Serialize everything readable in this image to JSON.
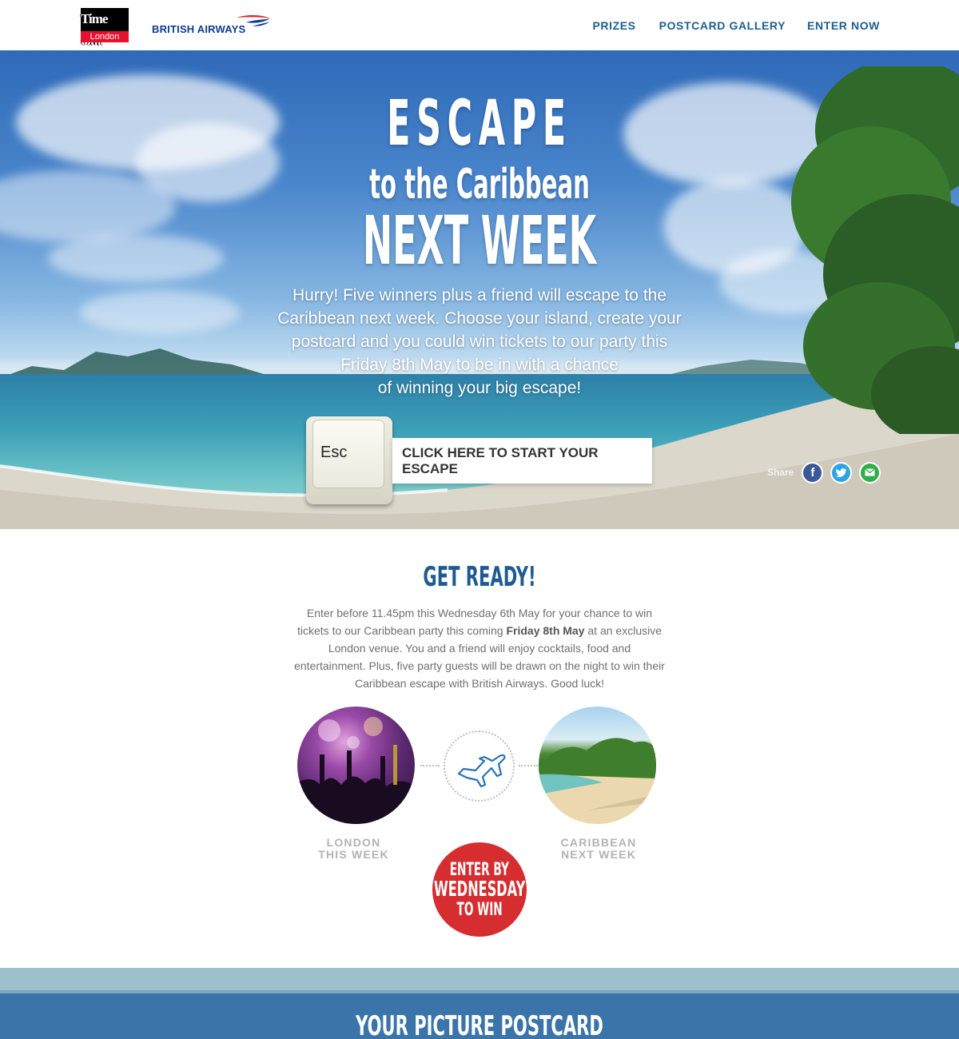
{
  "header": {
    "timeout_logo": {
      "main": "Time Out",
      "sub": "London"
    },
    "ba_logo": {
      "text": "BRITISH AIRWAYS"
    },
    "nav": [
      {
        "label": "PRIZES"
      },
      {
        "label": "POSTCARD GALLERY"
      },
      {
        "label": "ENTER NOW"
      }
    ]
  },
  "hero": {
    "title_line1": "ESCAPE",
    "title_line2": "to the Caribbean",
    "title_line3": "NEXT WEEK",
    "body_lines": [
      "Hurry! Five winners plus a friend will escape to the",
      "Caribbean next week. Choose your island, create your",
      "postcard and you could win tickets to our party this",
      "Friday 8th May to be in with a chance",
      "of winning your big escape!"
    ],
    "esc_key_label": "Esc",
    "cta_label": "CLICK HERE TO START YOUR ESCAPE",
    "share": {
      "label": "Share",
      "icons": [
        "facebook-icon",
        "twitter-icon",
        "email-icon"
      ],
      "colors": {
        "facebook": "#3b5998",
        "twitter": "#2ea3e3",
        "email": "#2fae4c"
      }
    }
  },
  "get_ready": {
    "title": "GET READY!",
    "body_part1": "Enter before 11.45pm this Wednesday 6th May for your chance to win tickets to our Caribbean party this coming ",
    "body_bold": "Friday 8th May",
    "body_part2": " at an exclusive London venue. You and a friend will enjoy cocktails, food and entertainment. Plus, five party guests will be drawn on the night to win their Caribbean escape with British Airways. Good luck!",
    "london_label_1": "LONDON",
    "london_label_2": "THIS WEEK",
    "caribbean_label_1": "CARIBBEAN",
    "caribbean_label_2": "NEXT WEEK",
    "plane_icon": "plane-icon",
    "badge_line1": "ENTER BY",
    "badge_line2": "WEDNESDAY",
    "badge_line3": "TO WIN"
  },
  "postcard": {
    "title": "YOUR PICTURE POSTCARD"
  },
  "colors": {
    "brand_blue": "#1f5b93",
    "nav_blue": "#1e5e92",
    "badge_red": "#d62d30",
    "muted_grey": "#b3b3b3"
  }
}
